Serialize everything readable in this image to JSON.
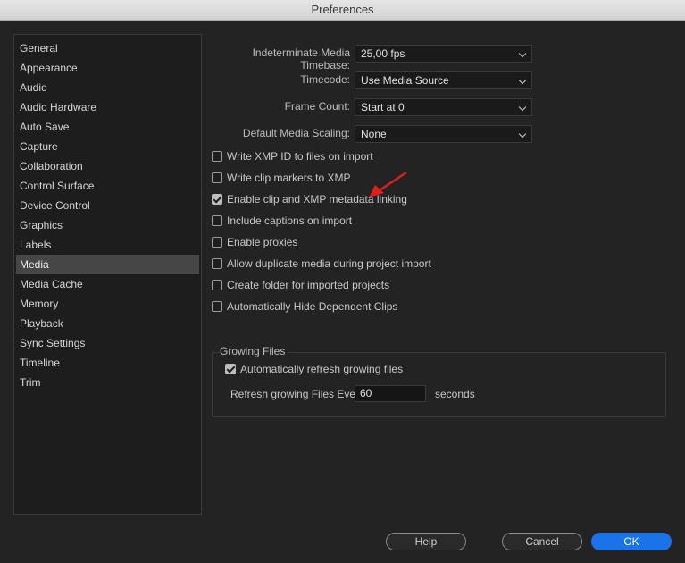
{
  "window": {
    "title": "Preferences"
  },
  "sidebar": {
    "items": [
      {
        "label": "General",
        "selected": false
      },
      {
        "label": "Appearance",
        "selected": false
      },
      {
        "label": "Audio",
        "selected": false
      },
      {
        "label": "Audio Hardware",
        "selected": false
      },
      {
        "label": "Auto Save",
        "selected": false
      },
      {
        "label": "Capture",
        "selected": false
      },
      {
        "label": "Collaboration",
        "selected": false
      },
      {
        "label": "Control Surface",
        "selected": false
      },
      {
        "label": "Device Control",
        "selected": false
      },
      {
        "label": "Graphics",
        "selected": false
      },
      {
        "label": "Labels",
        "selected": false
      },
      {
        "label": "Media",
        "selected": true
      },
      {
        "label": "Media Cache",
        "selected": false
      },
      {
        "label": "Memory",
        "selected": false
      },
      {
        "label": "Playback",
        "selected": false
      },
      {
        "label": "Sync Settings",
        "selected": false
      },
      {
        "label": "Timeline",
        "selected": false
      },
      {
        "label": "Trim",
        "selected": false
      }
    ]
  },
  "media": {
    "timebase": {
      "label": "Indeterminate Media Timebase:",
      "value": "25,00 fps"
    },
    "timecode": {
      "label": "Timecode:",
      "value": "Use Media Source"
    },
    "frame_count": {
      "label": "Frame Count:",
      "value": "Start at 0"
    },
    "scaling": {
      "label": "Default Media Scaling:",
      "value": "None"
    },
    "checkboxes": [
      {
        "label": "Write XMP ID to files on import",
        "checked": false
      },
      {
        "label": "Write clip markers to XMP",
        "checked": false
      },
      {
        "label": "Enable clip and XMP metadata linking",
        "checked": true
      },
      {
        "label": "Include captions on import",
        "checked": false
      },
      {
        "label": "Enable proxies",
        "checked": false
      },
      {
        "label": "Allow duplicate media during project import",
        "checked": false
      },
      {
        "label": "Create folder for imported projects",
        "checked": false
      },
      {
        "label": "Automatically Hide Dependent Clips",
        "checked": false
      }
    ]
  },
  "growing_files": {
    "title": "Growing Files",
    "auto_refresh": {
      "label": "Automatically refresh growing files",
      "checked": true
    },
    "refresh_label": "Refresh growing Files Every",
    "refresh_value": "60",
    "unit": "seconds"
  },
  "buttons": {
    "help": "Help",
    "cancel": "Cancel",
    "ok": "OK"
  },
  "colors": {
    "accent": "#1a73e8",
    "annotation_arrow": "#e01e1e"
  }
}
